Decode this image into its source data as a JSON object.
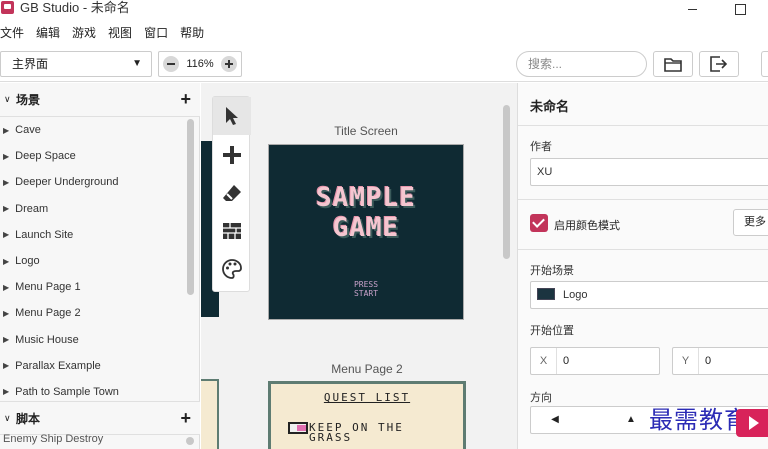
{
  "window": {
    "title": "GB Studio - 未命名"
  },
  "menu": [
    "文件",
    "编辑",
    "游戏",
    "视图",
    "窗口",
    "帮助"
  ],
  "toolbar": {
    "scene_view": "主界面",
    "zoom": "116%",
    "search_placeholder": "搜索..."
  },
  "sidebar": {
    "scenes_header": "场景",
    "scenes": [
      "Cave",
      "Deep Space",
      "Deeper Underground",
      "Dream",
      "Launch Site",
      "Logo",
      "Menu Page 1",
      "Menu Page 2",
      "Music House",
      "Parallax Example",
      "Path to Sample Town"
    ],
    "scripts_header": "脚本",
    "scripts": [
      "Enemy Ship Destroy"
    ]
  },
  "canvas": {
    "scene1": {
      "label": "Title Screen",
      "logo_line1": "SAMPLE",
      "logo_line2": "GAME",
      "press_line1": "PRESS",
      "press_line2": "START"
    },
    "scene2": {
      "label": "Menu Page 2",
      "title": "QUEST LIST",
      "line1": "KEEP ON THE",
      "line2": "GRASS"
    }
  },
  "panel": {
    "project_title": "未命名",
    "author_label": "作者",
    "author_value": "XU",
    "color_mode_label": "启用颜色模式",
    "more_button": "更多",
    "start_scene_label": "开始场景",
    "start_scene_value": "Logo",
    "start_position_label": "开始位置",
    "x_axis": "X",
    "x_value": "0",
    "y_axis": "Y",
    "y_value": "0",
    "direction_label": "方向",
    "direction_left": "◀",
    "direction_up": "▲"
  },
  "watermark": {
    "text": "最需教育"
  },
  "colors": {
    "accent": "#c2345a",
    "scene_bg": "#0f2a33",
    "menu_bg": "#f5ead1"
  }
}
